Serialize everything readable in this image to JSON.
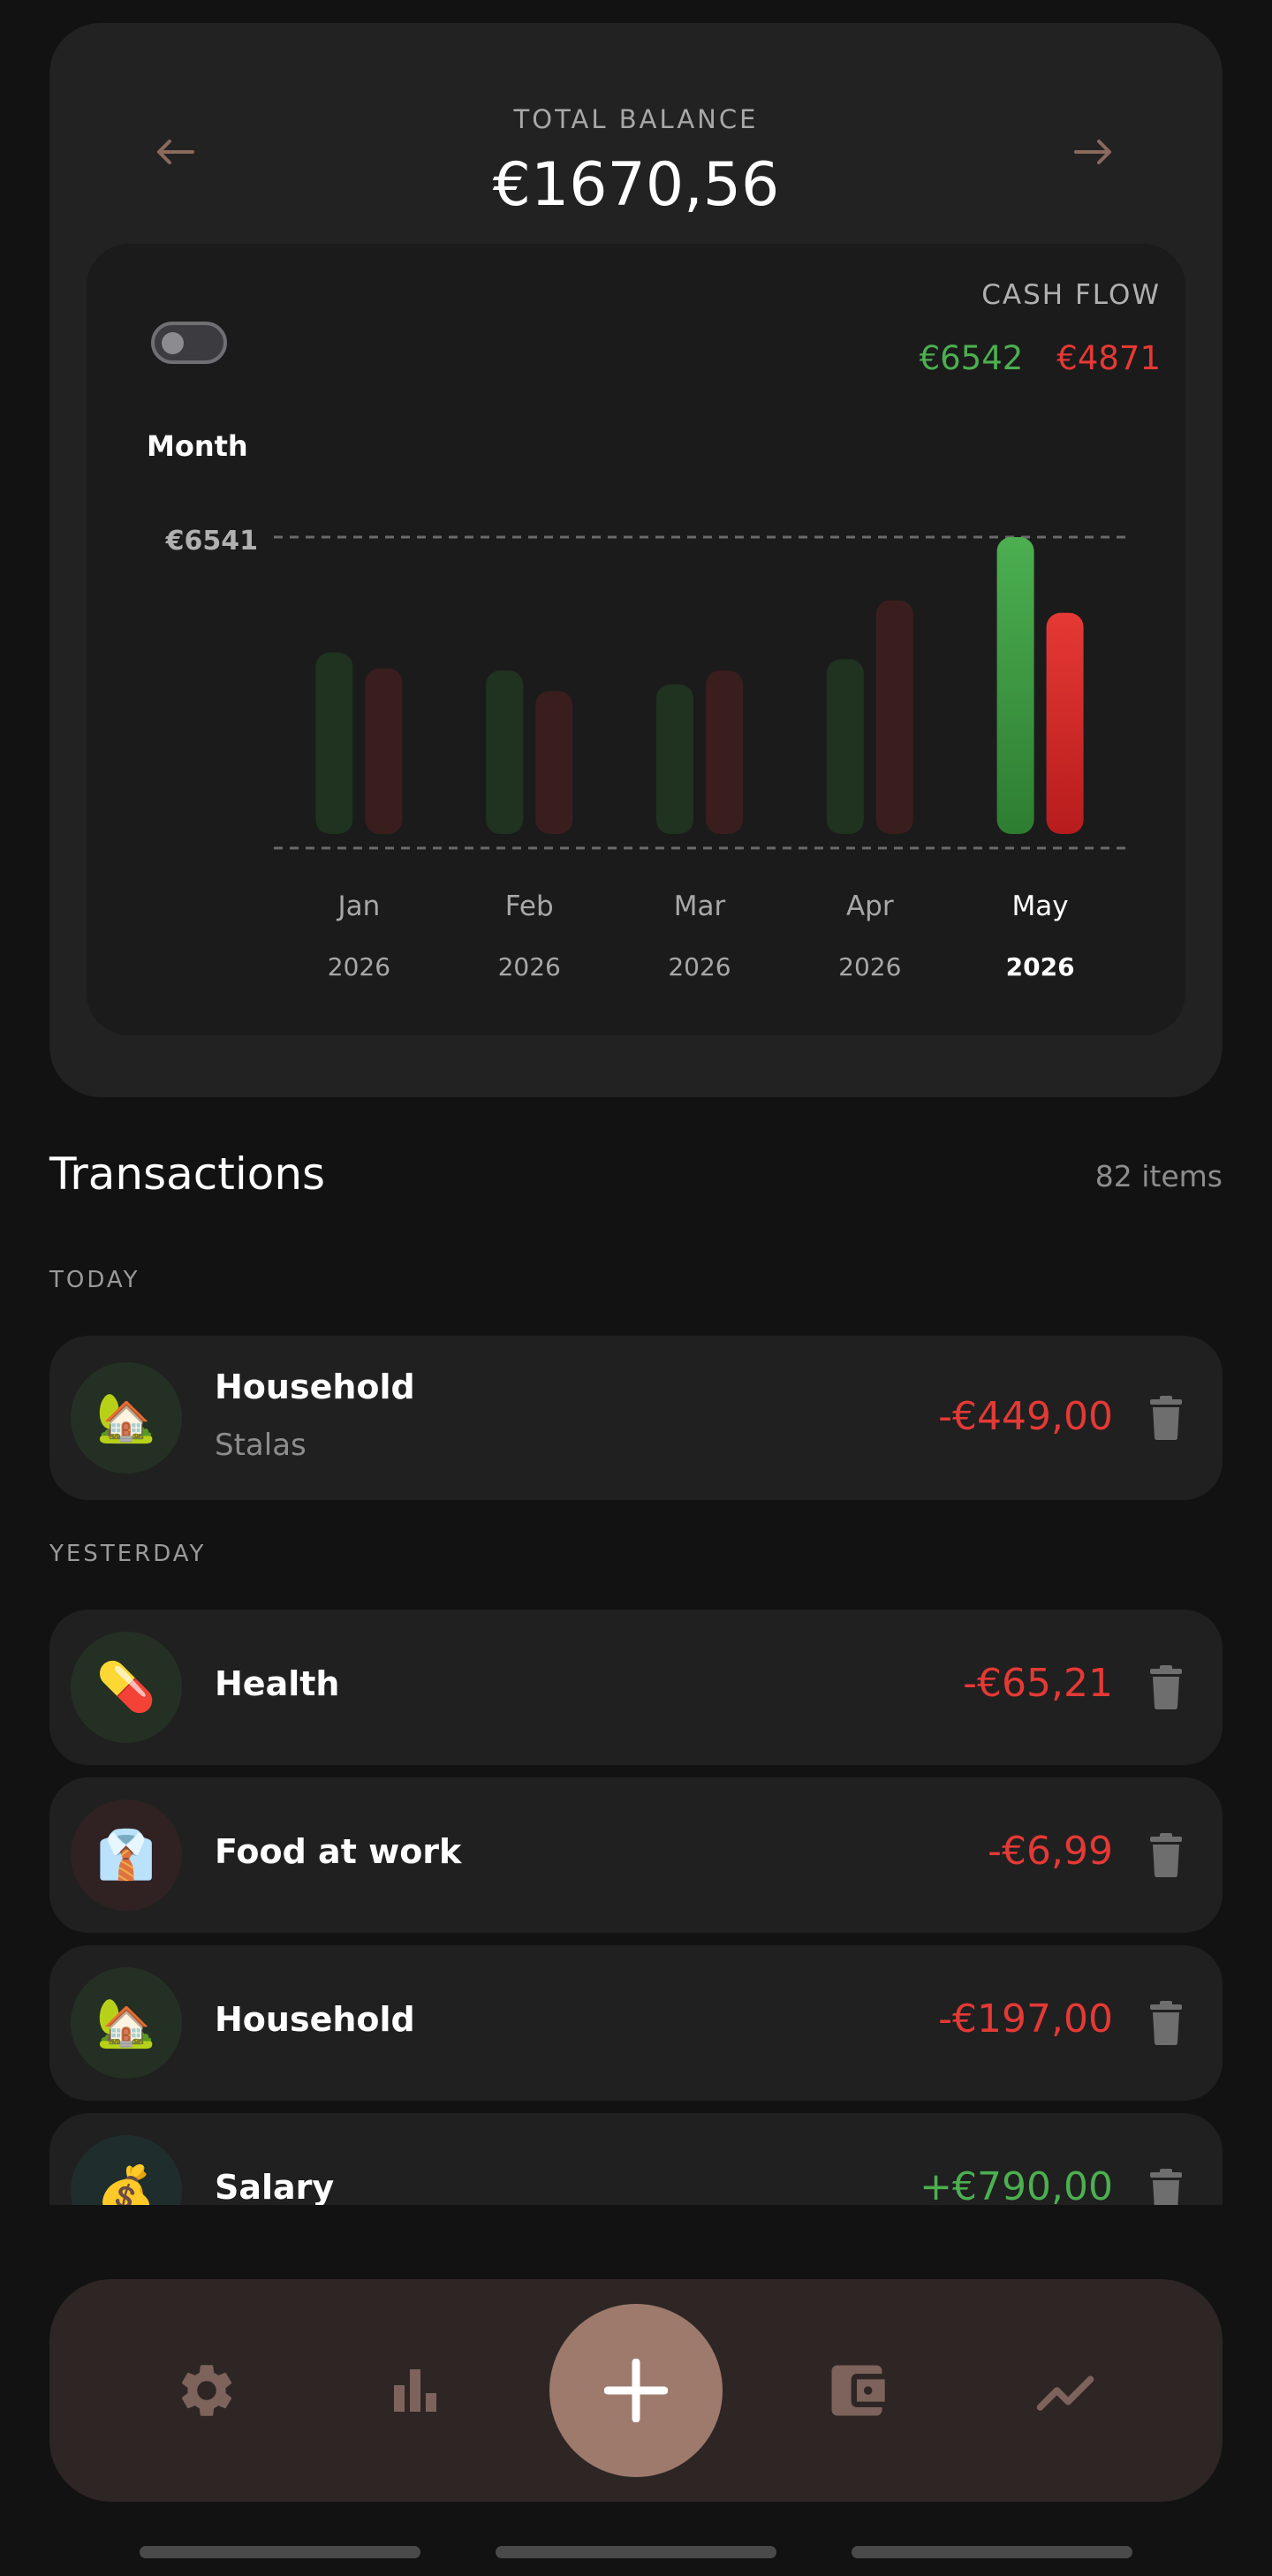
{
  "balance": {
    "label": "TOTAL BALANCE",
    "value": "€1670,56",
    "prev_icon": "arrow-left-icon",
    "next_icon": "arrow-right-icon"
  },
  "cash_flow": {
    "label": "CASH FLOW",
    "income": "€6542",
    "expense": "€4871",
    "period_label": "Month",
    "toggle_on": false
  },
  "chart_data": {
    "type": "bar",
    "categories": [
      "Jan",
      "Feb",
      "Mar",
      "Apr",
      "May"
    ],
    "years": [
      "2026",
      "2026",
      "2026",
      "2026",
      "2026"
    ],
    "selected_index": 4,
    "reference_line_label": "€6541",
    "reference_value": 6541,
    "series": [
      {
        "values": [
          4000,
          3600,
          3300,
          3850,
          6541
        ]
      },
      {
        "values": [
          3650,
          3150,
          3600,
          5150,
          4871
        ]
      }
    ],
    "ylim": [
      0,
      6541
    ],
    "colors": {
      "income": "#43a047",
      "expense": "#e53935",
      "income_dim": "#1f3320",
      "expense_dim": "#3a1e1e"
    }
  },
  "transactions": {
    "title": "Transactions",
    "count": "82 items",
    "groups": [
      {
        "label": "TODAY",
        "items": [
          {
            "icon": "🏡",
            "category": "Household",
            "note": "Stalas",
            "amount": "-€449,00"
          }
        ]
      },
      {
        "label": "YESTERDAY",
        "items": [
          {
            "icon": "💊",
            "category": "Health",
            "note": "",
            "amount": "-€65,21"
          },
          {
            "icon": "👔",
            "category": "Food at work",
            "note": "",
            "amount": "-€6,99"
          },
          {
            "icon": "🏡",
            "category": "Household",
            "note": "",
            "amount": "-€197,00"
          },
          {
            "icon": "💰",
            "category": "Salary",
            "note": "",
            "amount": "+€790,00"
          }
        ]
      }
    ]
  },
  "nav": {
    "items": [
      "gear-icon",
      "bar-chart-icon",
      "plus-icon",
      "wallet-icon",
      "trend-icon"
    ]
  }
}
